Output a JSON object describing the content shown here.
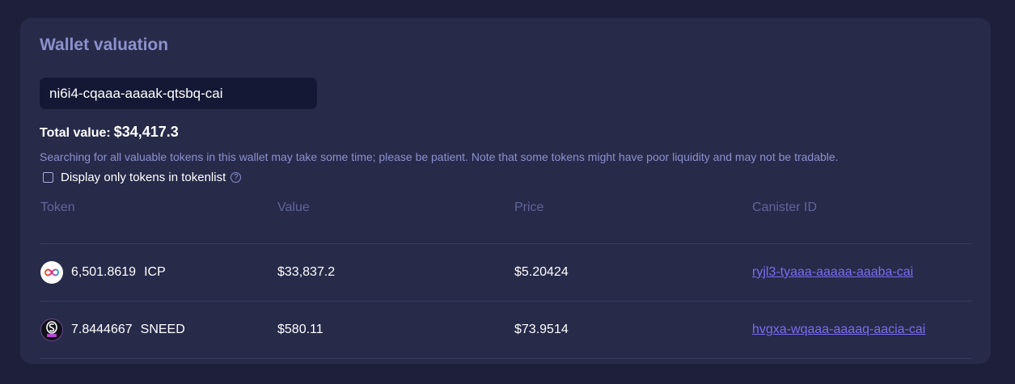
{
  "card": {
    "title": "Wallet valuation",
    "wallet_input_value": "ni6i4-cqaaa-aaaak-qtsbq-cai",
    "total_label": "Total value:",
    "total_value": "$34,417.3",
    "note": "Searching for all valuable tokens in this wallet may take some time; please be patient. Note that some tokens might have poor liquidity and may not be tradable.",
    "checkbox_label": "Display only tokens in tokenlist",
    "help_glyph": "?"
  },
  "table": {
    "headers": [
      "Token",
      "Value",
      "Price",
      "Canister ID"
    ],
    "rows": [
      {
        "amount": "6,501.8619",
        "symbol": "ICP",
        "value": "$33,837.2",
        "price": "$5.20424",
        "canister": "ryjl3-tyaaa-aaaaa-aaaba-cai",
        "icon": "icp-logo-icon"
      },
      {
        "amount": "7.8444667",
        "symbol": "SNEED",
        "value": "$580.11",
        "price": "$73.9514",
        "canister": "hvgxa-wqaaa-aaaaq-aacia-cai",
        "icon": "sneed-logo-icon"
      }
    ]
  },
  "colors": {
    "background": "#1e1f3b",
    "card": "#282a4a",
    "title": "#8a92cc",
    "link": "#7b6cf0"
  }
}
